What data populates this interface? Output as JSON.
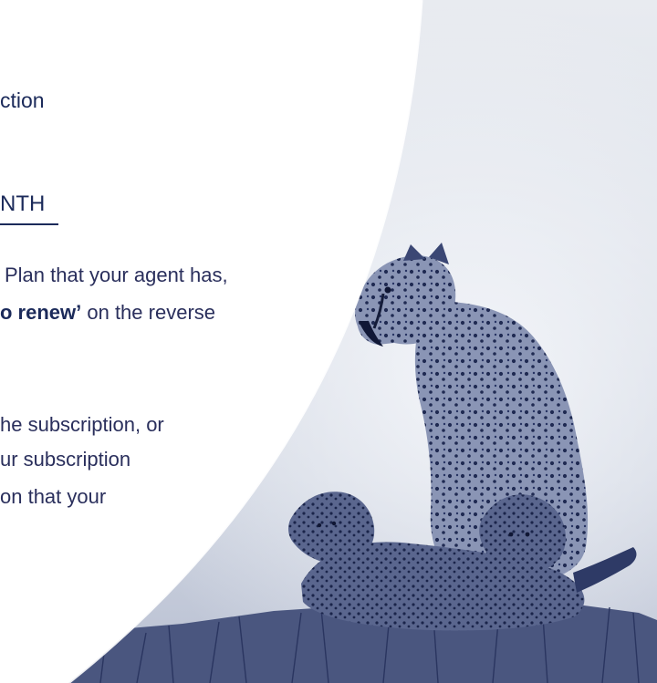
{
  "heading_fragment": "ction",
  "section_title_fragment": "NTH",
  "paragraph1": {
    "line1": "Plan that your agent has,",
    "line2_bold": "o renew’",
    "line2_rest": " on the reverse"
  },
  "paragraph2": {
    "line1": "he subscription, or",
    "line2": "ur subscription",
    "line3": "on that your"
  },
  "colors": {
    "text": "#2a2f5c",
    "accent": "#1b2a5a",
    "photo_tone": "#3a4a78"
  }
}
